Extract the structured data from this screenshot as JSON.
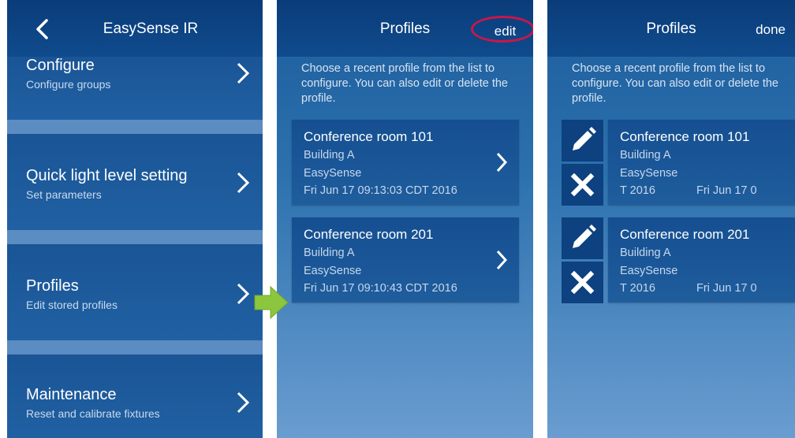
{
  "panel1": {
    "title": "EasySense IR",
    "items": [
      {
        "title": "Configure",
        "subtitle": "Configure groups"
      },
      {
        "title": "Quick light level setting",
        "subtitle": "Set parameters"
      },
      {
        "title": "Profiles",
        "subtitle": "Edit stored profiles"
      },
      {
        "title": "Maintenance",
        "subtitle": "Reset and calibrate fixtures"
      }
    ]
  },
  "panel2": {
    "title": "Profiles",
    "action": "edit",
    "intro": "Choose a recent profile from the list to configure. You can also edit or delete the profile.",
    "profiles": [
      {
        "name": "Conference room 101",
        "building": "Building A",
        "system": "EasySense",
        "date": "Fri Jun 17 09:13:03 CDT 2016"
      },
      {
        "name": "Conference room 201",
        "building": "Building A",
        "system": "EasySense",
        "date": "Fri Jun 17 09:10:43 CDT 2016"
      }
    ]
  },
  "panel3": {
    "title": "Profiles",
    "action": "done",
    "intro": "Choose a recent profile from the list to configure. You can also edit or delete the profile.",
    "profiles": [
      {
        "name": "Conference room 101",
        "building": "Building A",
        "system": "EasySense",
        "date_fragment": "T 2016",
        "date_clipped": "Fri Jun 17 0"
      },
      {
        "name": "Conference room 201",
        "building": "Building A",
        "system": "EasySense",
        "date_fragment": "T 2016",
        "date_clipped": "Fri Jun 17 0"
      }
    ]
  },
  "colors": {
    "accent_ring": "#c8174a",
    "arrow_green": "#8cc63f"
  }
}
